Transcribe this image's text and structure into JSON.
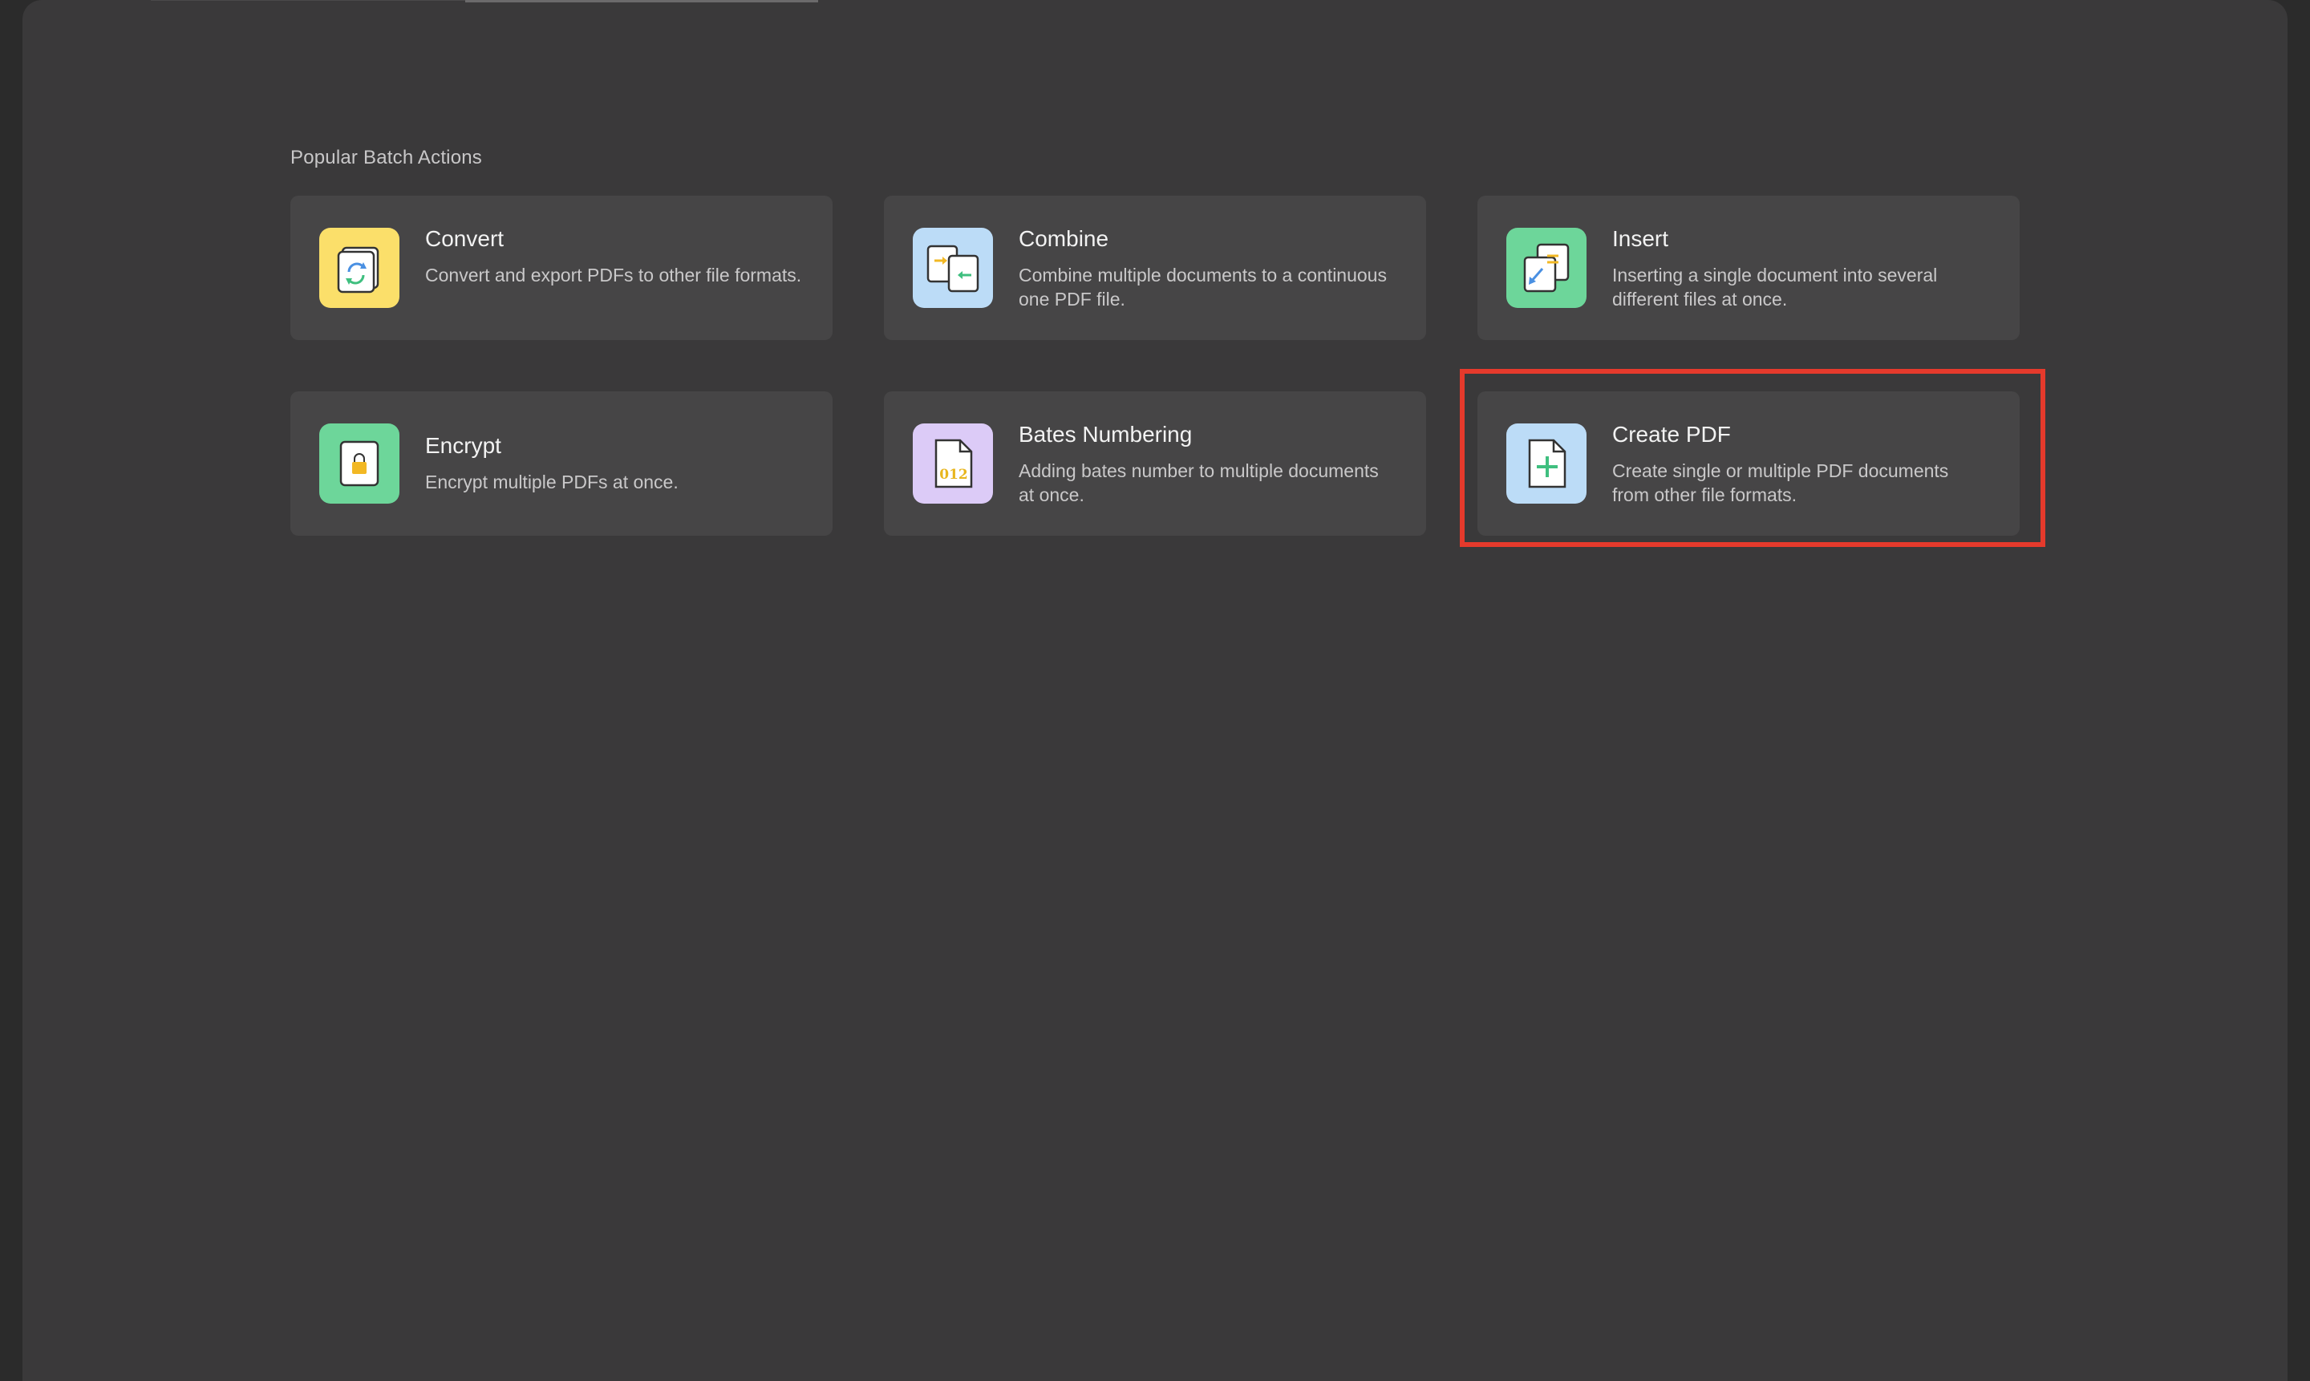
{
  "section": {
    "title": "Popular Batch Actions"
  },
  "actions": [
    {
      "title": "Convert",
      "description": "Convert and export PDFs to other file formats.",
      "icon": "convert-icon",
      "tile_color": "#fbdf6a"
    },
    {
      "title": "Combine",
      "description": "Combine multiple documents to a continuous one PDF file.",
      "icon": "combine-icon",
      "tile_color": "#bcdcf7"
    },
    {
      "title": "Insert",
      "description": "Inserting a single document into several different files at once.",
      "icon": "insert-icon",
      "tile_color": "#6dd69a"
    },
    {
      "title": "Encrypt",
      "description": "Encrypt multiple PDFs at once.",
      "icon": "lock-icon",
      "tile_color": "#6dd69a"
    },
    {
      "title": "Bates Numbering",
      "description": "Adding bates number to multiple documents at once.",
      "icon": "bates-number-icon",
      "icon_text": "012",
      "tile_color": "#dccbf7"
    },
    {
      "title": "Create PDF",
      "description": "Create single or multiple PDF documents from other file formats.",
      "icon": "create-pdf-icon",
      "tile_color": "#bcdcf7"
    }
  ],
  "colors": {
    "background": "#3a393a",
    "card": "#464546",
    "highlight": "#e53a2c"
  }
}
